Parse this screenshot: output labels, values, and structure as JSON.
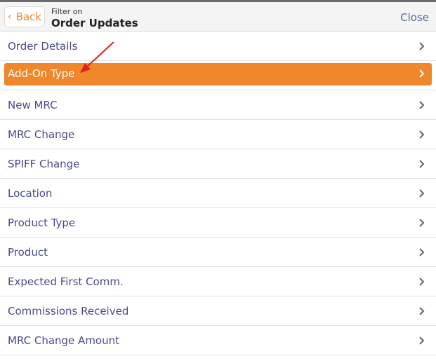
{
  "header": {
    "back_label": "Back",
    "filter_subtitle": "Filter on",
    "filter_title": "Order Updates",
    "close_label": "Close"
  },
  "list": {
    "items": [
      {
        "label": "Order Details",
        "selected": false
      },
      {
        "label": "Add-On Type",
        "selected": true
      },
      {
        "label": "New MRC",
        "selected": false
      },
      {
        "label": "MRC Change",
        "selected": false
      },
      {
        "label": "SPIFF Change",
        "selected": false
      },
      {
        "label": "Location",
        "selected": false
      },
      {
        "label": "Product Type",
        "selected": false
      },
      {
        "label": "Product",
        "selected": false
      },
      {
        "label": "Expected First Comm.",
        "selected": false
      },
      {
        "label": "Commissions Received",
        "selected": false
      },
      {
        "label": "MRC Change Amount",
        "selected": false
      }
    ]
  },
  "colors": {
    "accent": "#f0872a",
    "label_text": "#4a4a8a",
    "annotation_arrow": "#e02020"
  },
  "icons": {
    "back": "chevron-left-icon",
    "row": "chevron-right-icon",
    "annotation": "red-arrow"
  }
}
